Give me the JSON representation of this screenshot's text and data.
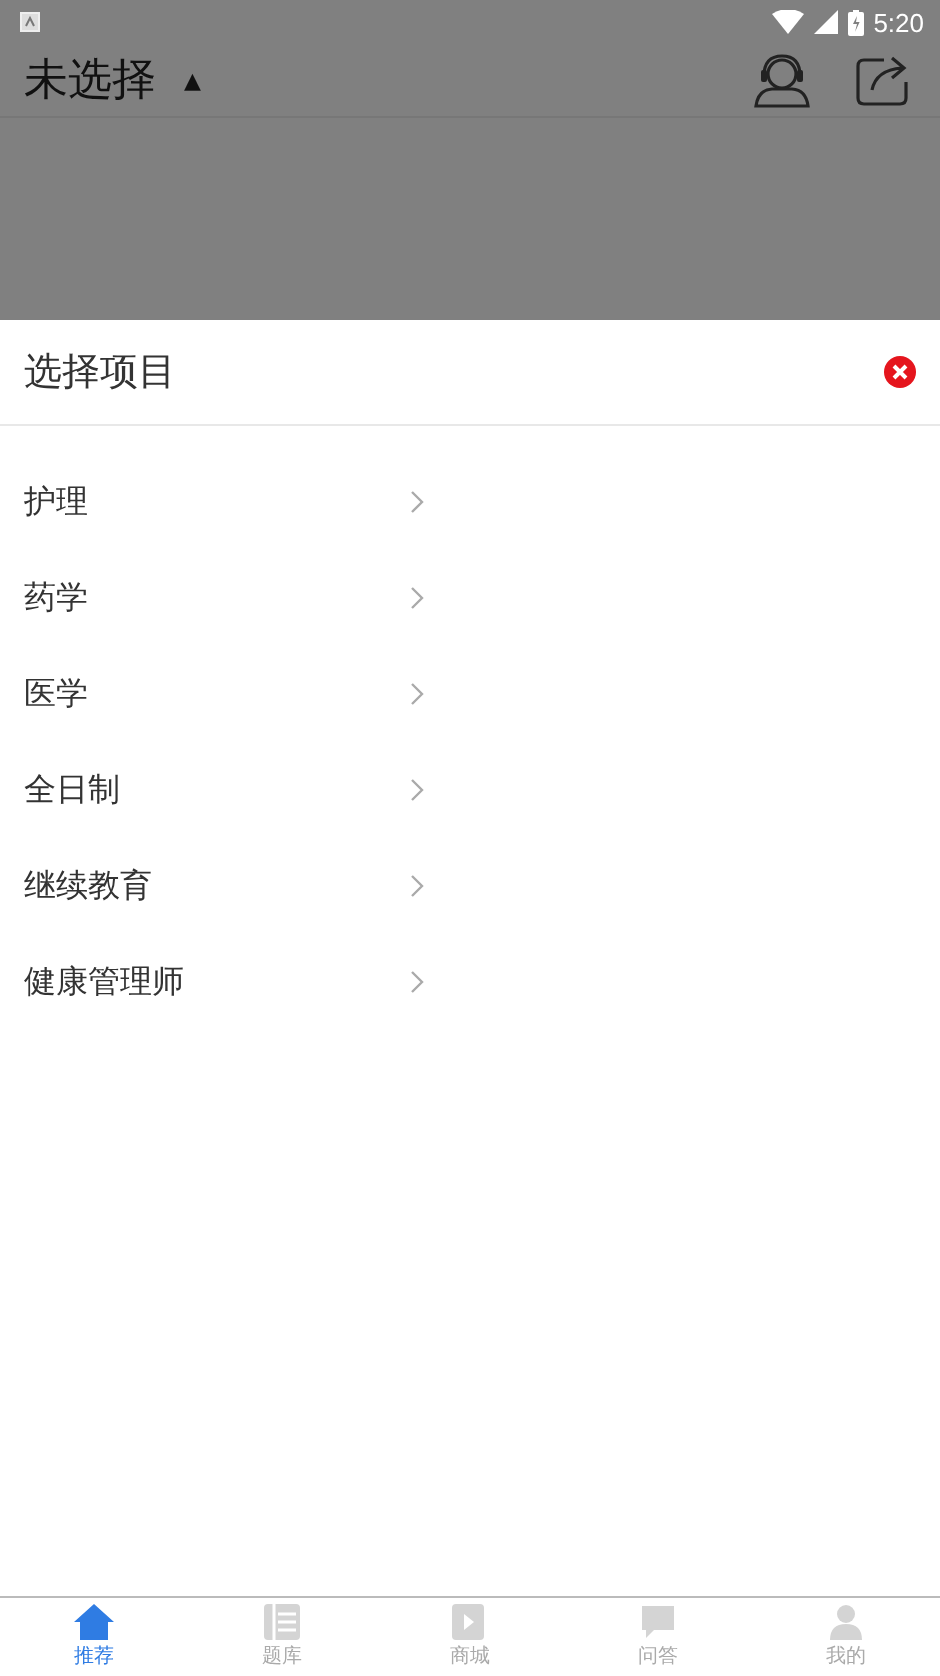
{
  "status_bar": {
    "time": "5:20"
  },
  "header": {
    "title": "未选择",
    "caret": "▲"
  },
  "sheet": {
    "title": "选择项目",
    "items": [
      {
        "label": "护理"
      },
      {
        "label": "药学"
      },
      {
        "label": "医学"
      },
      {
        "label": "全日制"
      },
      {
        "label": "继续教育"
      },
      {
        "label": "健康管理师"
      }
    ]
  },
  "tabs": [
    {
      "label": "推荐",
      "selected": true,
      "kind": "home"
    },
    {
      "label": "题库",
      "selected": false,
      "kind": "bank"
    },
    {
      "label": "商城",
      "selected": false,
      "kind": "mall"
    },
    {
      "label": "问答",
      "selected": false,
      "kind": "qa"
    },
    {
      "label": "我的",
      "selected": false,
      "kind": "me"
    }
  ]
}
